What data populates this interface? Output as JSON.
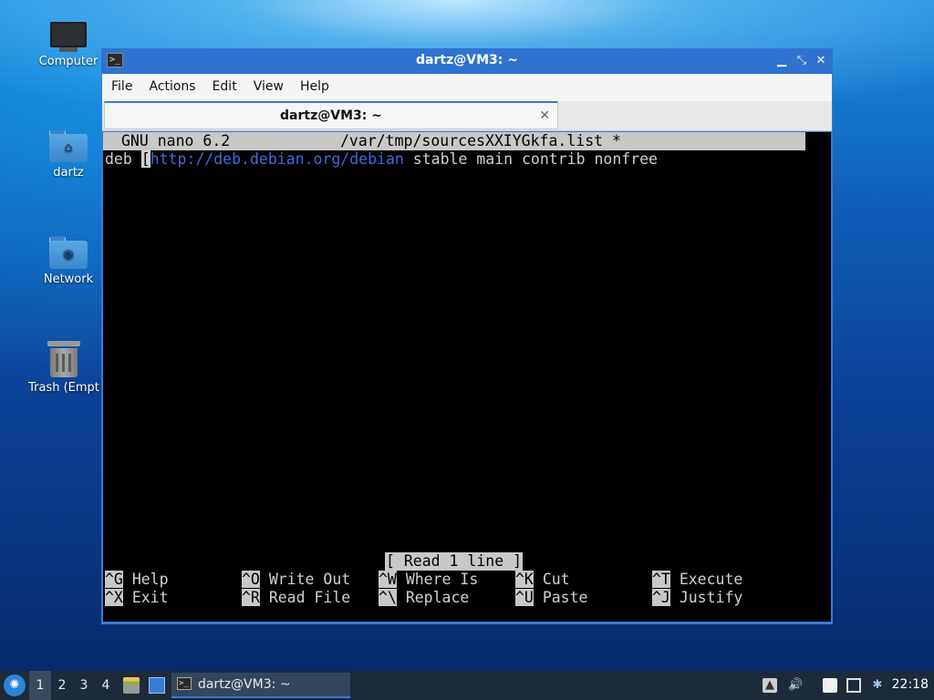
{
  "desktop": {
    "icons": [
      {
        "label": "Computer"
      },
      {
        "label": "dartz"
      },
      {
        "label": "Network"
      },
      {
        "label": "Trash (Empt"
      }
    ]
  },
  "window": {
    "title": "dartz@VM3: ~",
    "menu": [
      "File",
      "Actions",
      "Edit",
      "View",
      "Help"
    ],
    "tab_title": "dartz@VM3: ~",
    "controls": {
      "minimize": "▁",
      "maximize": "⤡",
      "close": "✕",
      "tab_close": "✕"
    }
  },
  "nano": {
    "version": "GNU nano 6.2",
    "filename": "/var/tmp/sourcesXXIYGkfa.list *",
    "line_prefix": "deb ",
    "cursor_char": "[",
    "url": "http://deb.debian.org/debian",
    "line_suffix": " stable main contrib nonfree",
    "status": "[ Read 1 line ]",
    "shortcuts": [
      {
        "key": "^G",
        "label": "Help"
      },
      {
        "key": "^O",
        "label": "Write Out"
      },
      {
        "key": "^W",
        "label": "Where Is"
      },
      {
        "key": "^K",
        "label": "Cut"
      },
      {
        "key": "^T",
        "label": "Execute"
      },
      {
        "key": "^X",
        "label": "Exit"
      },
      {
        "key": "^R",
        "label": "Read File"
      },
      {
        "key": "^\\",
        "label": "Replace"
      },
      {
        "key": "^U",
        "label": "Paste"
      },
      {
        "key": "^J",
        "label": "Justify"
      }
    ]
  },
  "taskbar": {
    "workspaces": [
      "1",
      "2",
      "3",
      "4"
    ],
    "active_workspace": "1",
    "task_label": "dartz@VM3: ~",
    "clock": "22:18",
    "tray_icons": [
      "updates-icon",
      "volume-icon",
      "clipboard-icon",
      "network-icon",
      "bluetooth-icon"
    ]
  },
  "colors": {
    "titlebar": "#2f73d0",
    "terminal_bg": "#000000",
    "nano_header": "#c8c8c8",
    "url": "#3d6be0",
    "taskbar": "#1d2a3a"
  }
}
